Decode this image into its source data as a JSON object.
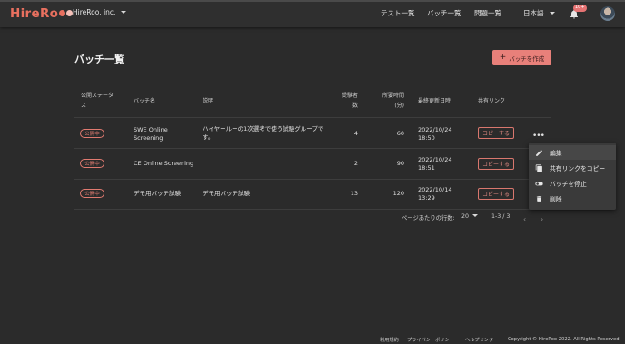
{
  "header": {
    "logo_text": "HireRo",
    "logo_dot_colors": [
      "#e8705f",
      "#f4c0b8"
    ],
    "company": "HireRoo, inc.",
    "nav": [
      "テスト一覧",
      "バッチ一覧",
      "問題一覧"
    ],
    "language": "日本語",
    "notification_count": "10+",
    "icons": {
      "bell": "bell-icon",
      "avatar": "user-avatar"
    }
  },
  "page": {
    "title": "バッチ一覧",
    "create_button": "バッチを作成",
    "accent_color": "#e8807a"
  },
  "table": {
    "headers": {
      "status_line1": "公開ステータ",
      "status_line2": "ス",
      "name": "バッチ名",
      "description": "説明",
      "candidates_line1": "受験者",
      "candidates_line2": "数",
      "duration_line1": "所要時間",
      "duration_line2": "(分)",
      "updated": "最終更新日時",
      "share": "共有リンク"
    },
    "rows": [
      {
        "status": "公開中",
        "name_line1": "SWE Online",
        "name_line2": "Screening",
        "description_line1": "ハイヤールーの1次選考で使う試験グループで",
        "description_line2": "す。",
        "candidates": "4",
        "duration": "60",
        "updated_date": "2022/10/24",
        "updated_time": "18:50",
        "copy_label": "コピーする"
      },
      {
        "status": "公開中",
        "name_line1": "CE Online Screening",
        "name_line2": "",
        "description_line1": "",
        "description_line2": "",
        "candidates": "2",
        "duration": "90",
        "updated_date": "2022/10/24",
        "updated_time": "18:51",
        "copy_label": "コピーする"
      },
      {
        "status": "公開中",
        "name_line1": "デモ用バッチ試験",
        "name_line2": "",
        "description_line1": "デモ用バッチ試験",
        "description_line2": "",
        "candidates": "13",
        "duration": "120",
        "updated_date": "2022/10/14",
        "updated_time": "13:29",
        "copy_label": "コピーする"
      }
    ]
  },
  "context_menu": {
    "items": [
      {
        "label": "編集",
        "icon": "pencil-icon"
      },
      {
        "label": "共有リンクをコピー",
        "icon": "copy-icon"
      },
      {
        "label": "バッチを停止",
        "icon": "toggle-icon"
      },
      {
        "label": "削除",
        "icon": "trash-icon"
      }
    ]
  },
  "pagination": {
    "rows_per_page_label": "ページあたりの行数:",
    "rows_per_page_value": "20",
    "range": "1-3 / 3"
  },
  "footer": {
    "links": [
      "利用規約",
      "プライバシーポリシー",
      "ヘルプセンター"
    ],
    "copyright": "Copyright © HireRoo 2022. All Rights Reserved."
  }
}
